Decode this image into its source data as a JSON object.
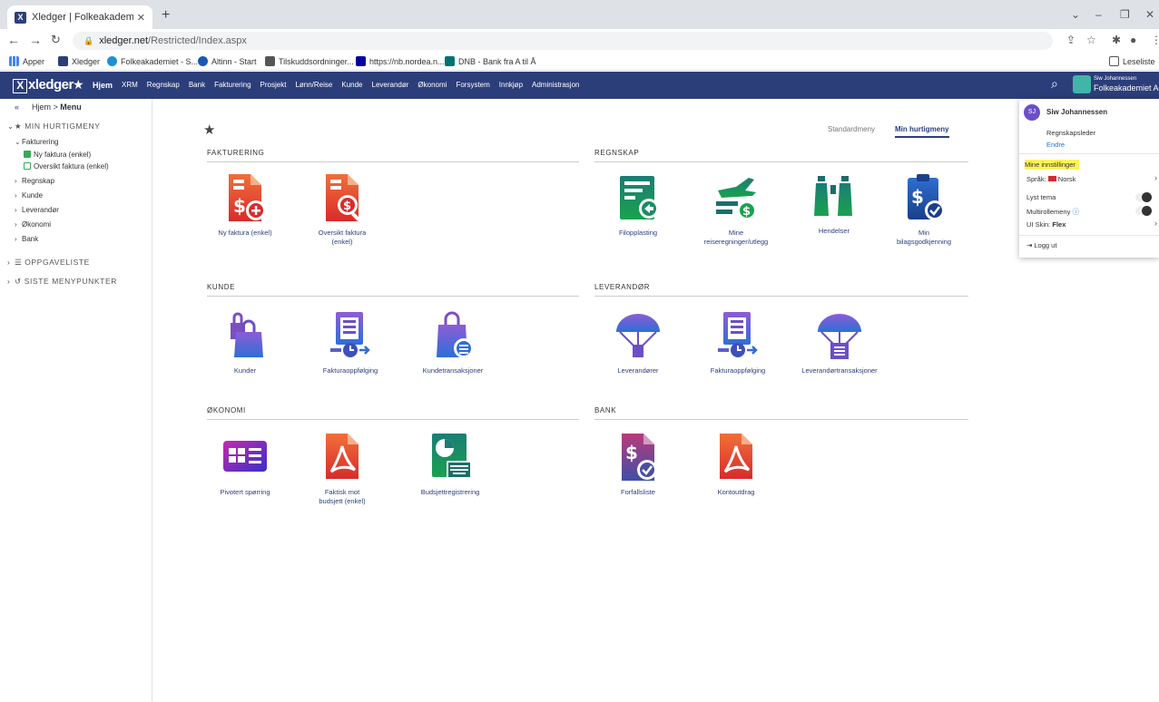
{
  "browser": {
    "tab_title": "Xledger | Folkeakademiet Agder",
    "url_host": "xledger.net",
    "url_path": "/Restricted/Index.aspx",
    "bookmarks": [
      "Apper",
      "Xledger",
      "Folkeakademiet - S...",
      "Altinn - Start",
      "Tilskuddsordninger...",
      "https://nb.nordea.n...",
      "DNB - Bank fra A til Å"
    ],
    "reading_list": "Leseliste"
  },
  "appbar": {
    "logo": "xledger",
    "menu": [
      "Hjem",
      "XRM",
      "Regnskap",
      "Bank",
      "Fakturering",
      "Prosjekt",
      "Lønn/Reise",
      "Kunde",
      "Leverandør",
      "Økonomi",
      "Forsystem",
      "Innkjøp",
      "Administrasjon"
    ],
    "user_small": "Siw Johannessen",
    "org": "Folkeakademiet Agd"
  },
  "sidebar": {
    "crumb_home": "Hjem",
    "crumb_current": "Menu",
    "favorites_header": "MIN HURTIGMENY",
    "fakturering": "Fakturering",
    "items": [
      "Ny faktura (enkel)",
      "Oversikt faktura (enkel)"
    ],
    "groups": [
      "Regnskap",
      "Kunde",
      "Leverandør",
      "Økonomi",
      "Bank"
    ],
    "tasks_header": "OPPGAVELISTE",
    "recent_header": "SISTE MENYPUNKTER"
  },
  "main": {
    "toggle_standard": "Standardmeny",
    "toggle_mine": "Min hurtigmeny",
    "sections": {
      "fakturering": "FAKTURERING",
      "regnskap": "REGNSKAP",
      "kunde": "KUNDE",
      "leverandor": "LEVERANDØR",
      "okonomi": "ØKONOMI",
      "bank": "BANK"
    },
    "tiles": {
      "ny_faktura": "Ny faktura (enkel)",
      "oversikt_faktura_1": "Oversikt faktura",
      "oversikt_faktura_2": "(enkel)",
      "filopplasting": "Filopplasting",
      "reise_1": "Mine",
      "reise_2": "reiseregninger/utlegg",
      "hendelser": "Hendelser",
      "bilag_1": "Min",
      "bilag_2": "bilagsgodkjenning",
      "kunder": "Kunder",
      "fakturaoppfolging_k": "Fakturaoppfølging",
      "kundetransaksjoner": "Kundetransaksjoner",
      "leverandorer": "Leverandører",
      "fakturaoppfolging_l": "Fakturaoppfølging",
      "levtrans": "Leverandørtransaksjoner",
      "pivot": "Pivotert spørring",
      "faktisk_1": "Faktisk mot",
      "faktisk_2": "budsjett (enkel)",
      "budsjett": "Budsjettregistrering",
      "forfall": "Forfallsliste",
      "konto": "Kontoutdrag"
    }
  },
  "popup": {
    "initials": "SJ",
    "name": "Siw Johannessen",
    "role": "Regnskapsleder",
    "edit": "Endre",
    "settings": "Mine innstillinger",
    "language_label": "Språk:",
    "language_value": "Norsk",
    "light_theme": "Lyst tema",
    "multirole": "Multirollemeny",
    "skin_label": "UI Skin:",
    "skin_value": "Flex",
    "logout": "Logg ut"
  }
}
